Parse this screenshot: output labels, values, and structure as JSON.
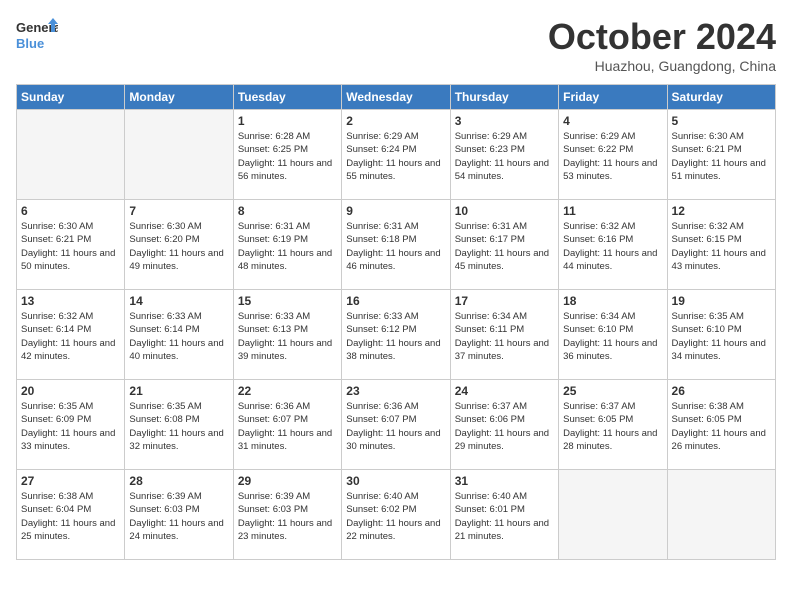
{
  "header": {
    "logo_line1": "General",
    "logo_line2": "Blue",
    "month_title": "October 2024",
    "location": "Huazhou, Guangdong, China"
  },
  "weekdays": [
    "Sunday",
    "Monday",
    "Tuesday",
    "Wednesday",
    "Thursday",
    "Friday",
    "Saturday"
  ],
  "weeks": [
    [
      {
        "day": "",
        "sunrise": "",
        "sunset": "",
        "daylight": "",
        "empty": true
      },
      {
        "day": "",
        "sunrise": "",
        "sunset": "",
        "daylight": "",
        "empty": true
      },
      {
        "day": "1",
        "sunrise": "Sunrise: 6:28 AM",
        "sunset": "Sunset: 6:25 PM",
        "daylight": "Daylight: 11 hours and 56 minutes.",
        "empty": false
      },
      {
        "day": "2",
        "sunrise": "Sunrise: 6:29 AM",
        "sunset": "Sunset: 6:24 PM",
        "daylight": "Daylight: 11 hours and 55 minutes.",
        "empty": false
      },
      {
        "day": "3",
        "sunrise": "Sunrise: 6:29 AM",
        "sunset": "Sunset: 6:23 PM",
        "daylight": "Daylight: 11 hours and 54 minutes.",
        "empty": false
      },
      {
        "day": "4",
        "sunrise": "Sunrise: 6:29 AM",
        "sunset": "Sunset: 6:22 PM",
        "daylight": "Daylight: 11 hours and 53 minutes.",
        "empty": false
      },
      {
        "day": "5",
        "sunrise": "Sunrise: 6:30 AM",
        "sunset": "Sunset: 6:21 PM",
        "daylight": "Daylight: 11 hours and 51 minutes.",
        "empty": false
      }
    ],
    [
      {
        "day": "6",
        "sunrise": "Sunrise: 6:30 AM",
        "sunset": "Sunset: 6:21 PM",
        "daylight": "Daylight: 11 hours and 50 minutes.",
        "empty": false
      },
      {
        "day": "7",
        "sunrise": "Sunrise: 6:30 AM",
        "sunset": "Sunset: 6:20 PM",
        "daylight": "Daylight: 11 hours and 49 minutes.",
        "empty": false
      },
      {
        "day": "8",
        "sunrise": "Sunrise: 6:31 AM",
        "sunset": "Sunset: 6:19 PM",
        "daylight": "Daylight: 11 hours and 48 minutes.",
        "empty": false
      },
      {
        "day": "9",
        "sunrise": "Sunrise: 6:31 AM",
        "sunset": "Sunset: 6:18 PM",
        "daylight": "Daylight: 11 hours and 46 minutes.",
        "empty": false
      },
      {
        "day": "10",
        "sunrise": "Sunrise: 6:31 AM",
        "sunset": "Sunset: 6:17 PM",
        "daylight": "Daylight: 11 hours and 45 minutes.",
        "empty": false
      },
      {
        "day": "11",
        "sunrise": "Sunrise: 6:32 AM",
        "sunset": "Sunset: 6:16 PM",
        "daylight": "Daylight: 11 hours and 44 minutes.",
        "empty": false
      },
      {
        "day": "12",
        "sunrise": "Sunrise: 6:32 AM",
        "sunset": "Sunset: 6:15 PM",
        "daylight": "Daylight: 11 hours and 43 minutes.",
        "empty": false
      }
    ],
    [
      {
        "day": "13",
        "sunrise": "Sunrise: 6:32 AM",
        "sunset": "Sunset: 6:14 PM",
        "daylight": "Daylight: 11 hours and 42 minutes.",
        "empty": false
      },
      {
        "day": "14",
        "sunrise": "Sunrise: 6:33 AM",
        "sunset": "Sunset: 6:14 PM",
        "daylight": "Daylight: 11 hours and 40 minutes.",
        "empty": false
      },
      {
        "day": "15",
        "sunrise": "Sunrise: 6:33 AM",
        "sunset": "Sunset: 6:13 PM",
        "daylight": "Daylight: 11 hours and 39 minutes.",
        "empty": false
      },
      {
        "day": "16",
        "sunrise": "Sunrise: 6:33 AM",
        "sunset": "Sunset: 6:12 PM",
        "daylight": "Daylight: 11 hours and 38 minutes.",
        "empty": false
      },
      {
        "day": "17",
        "sunrise": "Sunrise: 6:34 AM",
        "sunset": "Sunset: 6:11 PM",
        "daylight": "Daylight: 11 hours and 37 minutes.",
        "empty": false
      },
      {
        "day": "18",
        "sunrise": "Sunrise: 6:34 AM",
        "sunset": "Sunset: 6:10 PM",
        "daylight": "Daylight: 11 hours and 36 minutes.",
        "empty": false
      },
      {
        "day": "19",
        "sunrise": "Sunrise: 6:35 AM",
        "sunset": "Sunset: 6:10 PM",
        "daylight": "Daylight: 11 hours and 34 minutes.",
        "empty": false
      }
    ],
    [
      {
        "day": "20",
        "sunrise": "Sunrise: 6:35 AM",
        "sunset": "Sunset: 6:09 PM",
        "daylight": "Daylight: 11 hours and 33 minutes.",
        "empty": false
      },
      {
        "day": "21",
        "sunrise": "Sunrise: 6:35 AM",
        "sunset": "Sunset: 6:08 PM",
        "daylight": "Daylight: 11 hours and 32 minutes.",
        "empty": false
      },
      {
        "day": "22",
        "sunrise": "Sunrise: 6:36 AM",
        "sunset": "Sunset: 6:07 PM",
        "daylight": "Daylight: 11 hours and 31 minutes.",
        "empty": false
      },
      {
        "day": "23",
        "sunrise": "Sunrise: 6:36 AM",
        "sunset": "Sunset: 6:07 PM",
        "daylight": "Daylight: 11 hours and 30 minutes.",
        "empty": false
      },
      {
        "day": "24",
        "sunrise": "Sunrise: 6:37 AM",
        "sunset": "Sunset: 6:06 PM",
        "daylight": "Daylight: 11 hours and 29 minutes.",
        "empty": false
      },
      {
        "day": "25",
        "sunrise": "Sunrise: 6:37 AM",
        "sunset": "Sunset: 6:05 PM",
        "daylight": "Daylight: 11 hours and 28 minutes.",
        "empty": false
      },
      {
        "day": "26",
        "sunrise": "Sunrise: 6:38 AM",
        "sunset": "Sunset: 6:05 PM",
        "daylight": "Daylight: 11 hours and 26 minutes.",
        "empty": false
      }
    ],
    [
      {
        "day": "27",
        "sunrise": "Sunrise: 6:38 AM",
        "sunset": "Sunset: 6:04 PM",
        "daylight": "Daylight: 11 hours and 25 minutes.",
        "empty": false
      },
      {
        "day": "28",
        "sunrise": "Sunrise: 6:39 AM",
        "sunset": "Sunset: 6:03 PM",
        "daylight": "Daylight: 11 hours and 24 minutes.",
        "empty": false
      },
      {
        "day": "29",
        "sunrise": "Sunrise: 6:39 AM",
        "sunset": "Sunset: 6:03 PM",
        "daylight": "Daylight: 11 hours and 23 minutes.",
        "empty": false
      },
      {
        "day": "30",
        "sunrise": "Sunrise: 6:40 AM",
        "sunset": "Sunset: 6:02 PM",
        "daylight": "Daylight: 11 hours and 22 minutes.",
        "empty": false
      },
      {
        "day": "31",
        "sunrise": "Sunrise: 6:40 AM",
        "sunset": "Sunset: 6:01 PM",
        "daylight": "Daylight: 11 hours and 21 minutes.",
        "empty": false
      },
      {
        "day": "",
        "sunrise": "",
        "sunset": "",
        "daylight": "",
        "empty": true
      },
      {
        "day": "",
        "sunrise": "",
        "sunset": "",
        "daylight": "",
        "empty": true
      }
    ]
  ]
}
